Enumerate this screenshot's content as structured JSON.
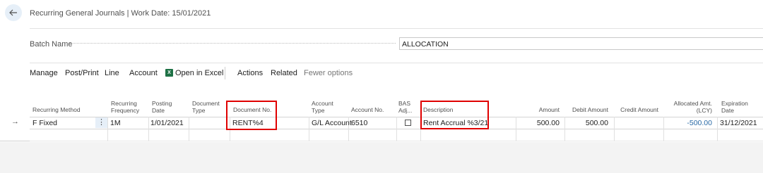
{
  "header": {
    "title": "Recurring General Journals | Work Date: 15/01/2021"
  },
  "batch": {
    "label": "Batch Name",
    "value": "ALLOCATION"
  },
  "actions": {
    "manage": "Manage",
    "post_print": "Post/Print",
    "line": "Line",
    "account": "Account",
    "open_excel": "Open in Excel",
    "actions": "Actions",
    "related": "Related",
    "fewer_options": "Fewer options"
  },
  "columns": {
    "recurring_method": "Recurring Method",
    "recurring_frequency": [
      "Recurring",
      "Frequency"
    ],
    "posting_date": [
      "Posting",
      "Date"
    ],
    "document_type": [
      "Document",
      "Type"
    ],
    "document_no": "Document No.",
    "account_type": [
      "Account",
      "Type"
    ],
    "account_no": "Account No.",
    "bas_adj": [
      "BAS",
      "Adj..."
    ],
    "description": "Description",
    "amount": "Amount",
    "debit_amount": "Debit Amount",
    "credit_amount": "Credit Amount",
    "allocated_amt": [
      "Allocated Amt.",
      "(LCY)"
    ],
    "expiration_date": [
      "Expiration",
      "Date"
    ]
  },
  "row": {
    "recurring_method": "F Fixed",
    "recurring_frequency": "1M",
    "posting_date": "1/01/2021",
    "document_type": "",
    "document_no": "RENT%4",
    "account_type": "G/L Account",
    "account_no": "6510",
    "bas_adj": false,
    "description": "Rent Accrual %3/21",
    "amount": "500.00",
    "debit_amount": "500.00",
    "credit_amount": "",
    "allocated_amt": "-500.00",
    "expiration_date": "31/12/2021"
  },
  "icons": {
    "back": "back-arrow-icon",
    "row_indicator": "right-arrow-icon",
    "excel": "excel-icon",
    "more": "more-options-icon"
  },
  "colors": {
    "highlight": "#e00000",
    "negative_amount": "#2a6aa6",
    "excel_green": "#1e7145"
  }
}
